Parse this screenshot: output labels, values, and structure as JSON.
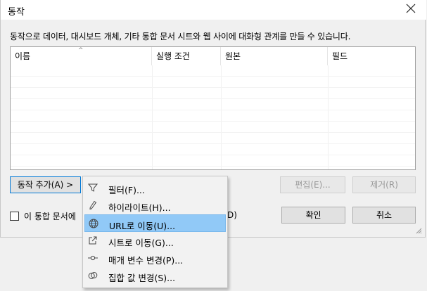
{
  "window": {
    "title": "동작"
  },
  "description": "동작으로 데이터, 대시보드 개체, 기타 통합 문서 시트와 웹 사이에 대화형 관계를 만들 수 있습니다.",
  "table": {
    "columns": [
      "이름",
      "실행 조건",
      "원본",
      "필드"
    ],
    "rows": []
  },
  "buttons": {
    "add_action": "동작 추가(A) >",
    "edit": "편집(E)...",
    "remove": "제거(R)",
    "ok": "확인",
    "cancel": "취소"
  },
  "checkbox": {
    "label": "이 통합 문서에",
    "label_tail": "D)",
    "checked": false
  },
  "menu": {
    "items": [
      {
        "label": "필터(F)...",
        "icon": "filter-icon"
      },
      {
        "label": "하이라이트(H)...",
        "icon": "highlight-pen-icon"
      },
      {
        "label": "URL로 이동(U)...",
        "icon": "globe-icon",
        "highlighted": true
      },
      {
        "label": "시트로 이동(G)...",
        "icon": "external-link-icon"
      },
      {
        "label": "매개 변수 변경(P)...",
        "icon": "parameter-icon"
      },
      {
        "label": "집합 값 변경(S)...",
        "icon": "set-icon"
      }
    ]
  },
  "colors": {
    "highlight": "#91c9f7",
    "primary_border": "#0078d7"
  }
}
